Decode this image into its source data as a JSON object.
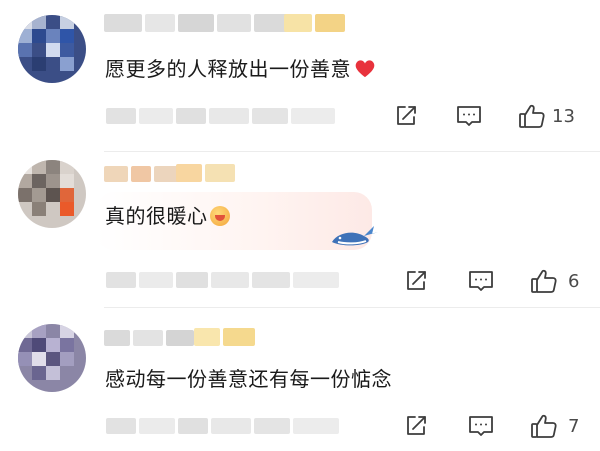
{
  "comments": [
    {
      "text": "愿更多的人释放出一份善意",
      "suffix_icon": "red-heart-icon",
      "likes": "13"
    },
    {
      "text": "真的很暖心",
      "suffix_icon": "hugging-face-emoji-icon",
      "decoration_icon": "whale-sticker-icon",
      "likes": "6"
    },
    {
      "text": "感动每一份善意还有每一份惦念",
      "likes": "7"
    }
  ],
  "icons": {
    "share": "share-icon",
    "reply": "comment-icon",
    "like": "thumbs-up-icon"
  },
  "colors": {
    "icon": "#3d3d3d",
    "heart": "#e8323c",
    "name_tag": "#f6d88a"
  }
}
